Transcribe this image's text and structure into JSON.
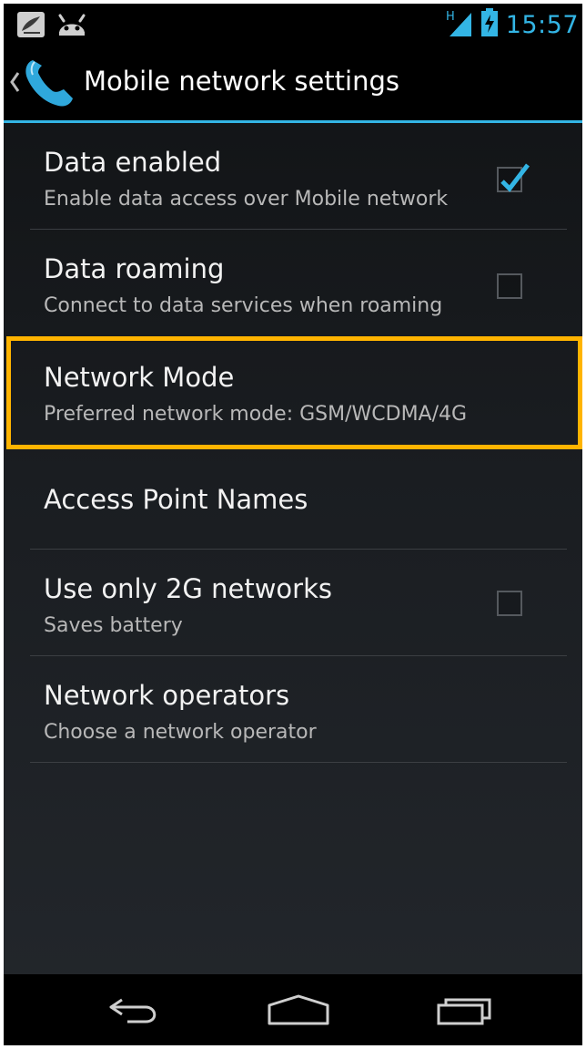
{
  "status_bar": {
    "time": "15:57",
    "network_type": "H",
    "icons": [
      "notification-icon",
      "android-icon",
      "signal-icon",
      "battery-charging-icon"
    ],
    "accent_color": "#33b5e5"
  },
  "action_bar": {
    "title": "Mobile network settings",
    "icon": "phone-icon"
  },
  "settings": {
    "data_enabled": {
      "title": "Data enabled",
      "summary": "Enable data access over Mobile network",
      "checked": true
    },
    "data_roaming": {
      "title": "Data roaming",
      "summary": "Connect to data services when roaming",
      "checked": false
    },
    "network_mode": {
      "title": "Network Mode",
      "summary": "Preferred network mode: GSM/WCDMA/4G",
      "highlight_color": "#ffb400"
    },
    "access_point_names": {
      "title": "Access Point Names"
    },
    "use_2g": {
      "title": "Use only 2G networks",
      "summary": "Saves battery",
      "checked": false
    },
    "network_operators": {
      "title": "Network operators",
      "summary": "Choose a network operator"
    }
  },
  "nav_bar": {
    "buttons": [
      "back-icon",
      "home-icon",
      "recent-apps-icon"
    ]
  }
}
